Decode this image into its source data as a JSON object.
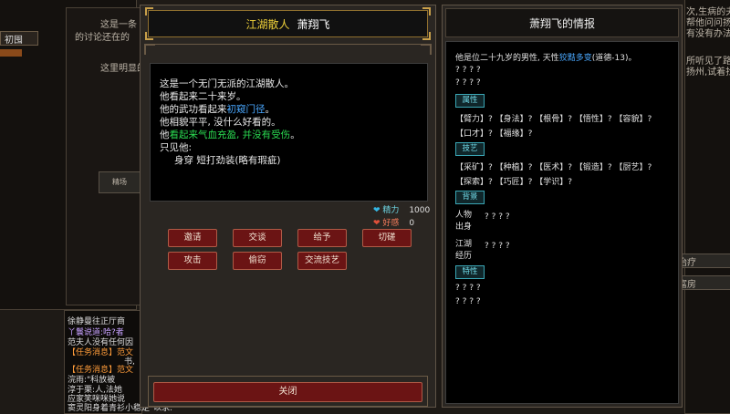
{
  "background": {
    "left_texts": [
      "这是一条",
      "的讨论还在的",
      "这里明显的",
      "初囤",
      "精场"
    ],
    "right_texts": [
      "次,生病的夫人",
      "帮他问问扬州",
      "有没有办法救他",
      "所听见了路人谈",
      "扬州,试着找到",
      "治疗",
      "富房"
    ],
    "chat_lines": [
      "徐静曼往正厅商",
      "丫鬟说道:哈?者",
      "范夫人没有任何因",
      "【任务消息】范文",
      "书,",
      "【任务消息】范文",
      "浣雨:\"科放被",
      "淳于栗:人,法她",
      "应家笑咪咪她说",
      "窦灵阳身着青衫小稳定\"以求."
    ]
  },
  "left_dialog": {
    "title_tag": "江湖散人",
    "title_name": "萧翔飞",
    "description_lines": [
      {
        "text": "这是一个无门无派的江湖散人。"
      },
      {
        "text": "他看起来二十来岁。"
      },
      {
        "prefix": "他的武功看起来",
        "highlight": "初窥门径",
        "suffix": "。"
      },
      {
        "text": "他相貌平平, 没什么好看的。"
      },
      {
        "prefix": "他",
        "highlight": "看起来气血充盈, 并没有受伤",
        "suffix": "。"
      },
      {
        "text": "只见他:"
      },
      {
        "text": "身穿 短打劲装(略有瑕疵)"
      }
    ],
    "stats": {
      "energy_label": "精力",
      "energy_value": "1000",
      "favor_label": "好感",
      "favor_value": "0"
    },
    "buttons": {
      "invite": "邀请",
      "talk": "交谈",
      "give": "给予",
      "spar": "切磋",
      "attack": "攻击",
      "steal": "偷窃",
      "exchange_skill": "交流技艺"
    },
    "close_label": "关闭"
  },
  "right_panel": {
    "title": "萧翔飞的情报",
    "intro_prefix": "他是位二十九岁的男性, 天性",
    "intro_trait": "狡黠多变",
    "intro_suffix": "(道德-13)。",
    "unknown": "? ? ? ?",
    "section_attributes": "属性",
    "attr_row1": "【臂力】?  【身法】?  【根骨】?  【悟性】?  【容貌】?",
    "attr_row2": "【口才】?  【福缘】?",
    "section_skills": "技艺",
    "skill_row1": "【采矿】?  【种植】?  【医术】?  【锻造】?  【厨艺】?",
    "skill_row2": "【探索】?  【巧匠】?  【学识】?",
    "section_background": "背景",
    "bg_origin_label_1": "人物",
    "bg_origin_label_2": "出身",
    "bg_history_label_1": "江湖",
    "bg_history_label_2": "经历",
    "section_traits": "特性"
  },
  "colors": {
    "highlight_blue": "#4aa8ff",
    "highlight_green": "#2ad850",
    "trait_blue": "#4aa8ff",
    "title_yellow": "#f0d23a",
    "heart_cyan": "#35b8e6",
    "heart_red": "#e0503a"
  }
}
